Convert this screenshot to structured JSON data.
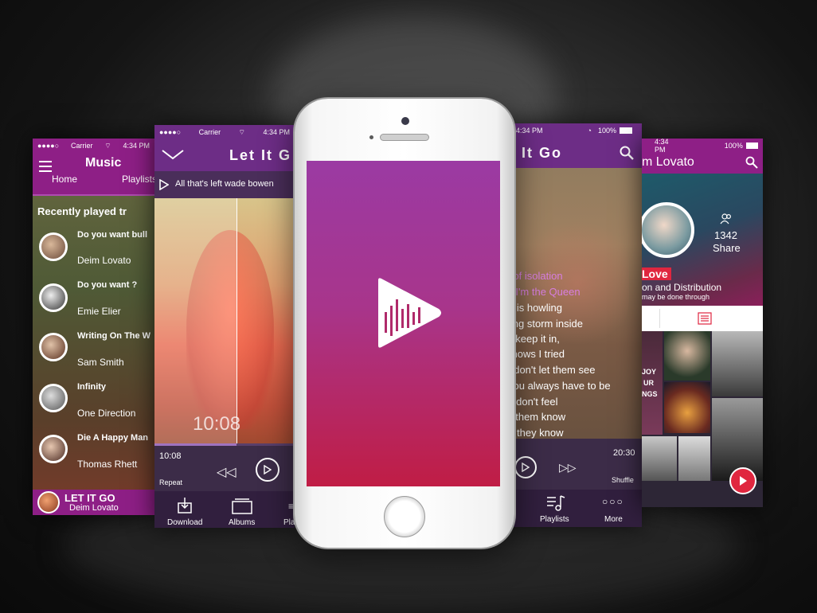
{
  "screen1": {
    "status": {
      "carrier": "Carrier",
      "time": "4:34 PM",
      "signal": "●●●●○"
    },
    "title": "Music",
    "nav": [
      "Home",
      "Playlists"
    ],
    "section_title": "Recently played tr",
    "songs": [
      {
        "title": "Do you want bull",
        "artist": "Deim Lovato"
      },
      {
        "title": "Do you want ?",
        "artist": "Emie Elier"
      },
      {
        "title": "Writing On The W",
        "artist": "Sam Smith"
      },
      {
        "title": "Infinity",
        "artist": "One Direction"
      },
      {
        "title": "Die A Happy Man",
        "artist": "Thomas Rhett"
      }
    ],
    "now_playing": {
      "title": "LET IT GO",
      "artist": "Deim Lovato"
    }
  },
  "screen2": {
    "status": {
      "carrier": "Carrier",
      "time": "4:34 PM",
      "signal": "●●●●○"
    },
    "title": "Let It G",
    "subtitle": "All that's left wade bowen",
    "big_time": "10:08",
    "elapsed": "10:08",
    "repeat": "Repeat",
    "tabs": [
      "Download",
      "Albums",
      "Pla"
    ]
  },
  "screen3": {
    "status": {
      "time": "4:34 PM",
      "battery": "100%"
    },
    "title": "It Go",
    "lyrics": [
      "m of isolation",
      "ke I'm the Queen",
      "d is howling",
      "ling storm inside",
      "t keep it in,",
      "knows I tried",
      ", don't let them see",
      "you always have to be",
      "l, don't feel",
      "t them know",
      "w they know"
    ],
    "remaining": "20:30",
    "shuffle": "Shuffle",
    "tabs": [
      "Playlists",
      "More"
    ]
  },
  "screen4": {
    "status": {
      "time": "4:34 PM",
      "battery": "100%"
    },
    "title": "m Lovato",
    "share_count": "1342",
    "share_label": "Share",
    "love_label": "Love",
    "distribution": "on and Distribution",
    "distribution_sub": "may be done through",
    "album_text": [
      "JOY",
      "UR",
      "NGS"
    ]
  },
  "colors": {
    "purple": "#6d2d86",
    "magenta": "#8e1f86",
    "lyric_highlight": "#d77ee0",
    "splash_top": "#9b3aa3",
    "splash_bottom": "#c01d45",
    "play_red": "#e0263f"
  }
}
